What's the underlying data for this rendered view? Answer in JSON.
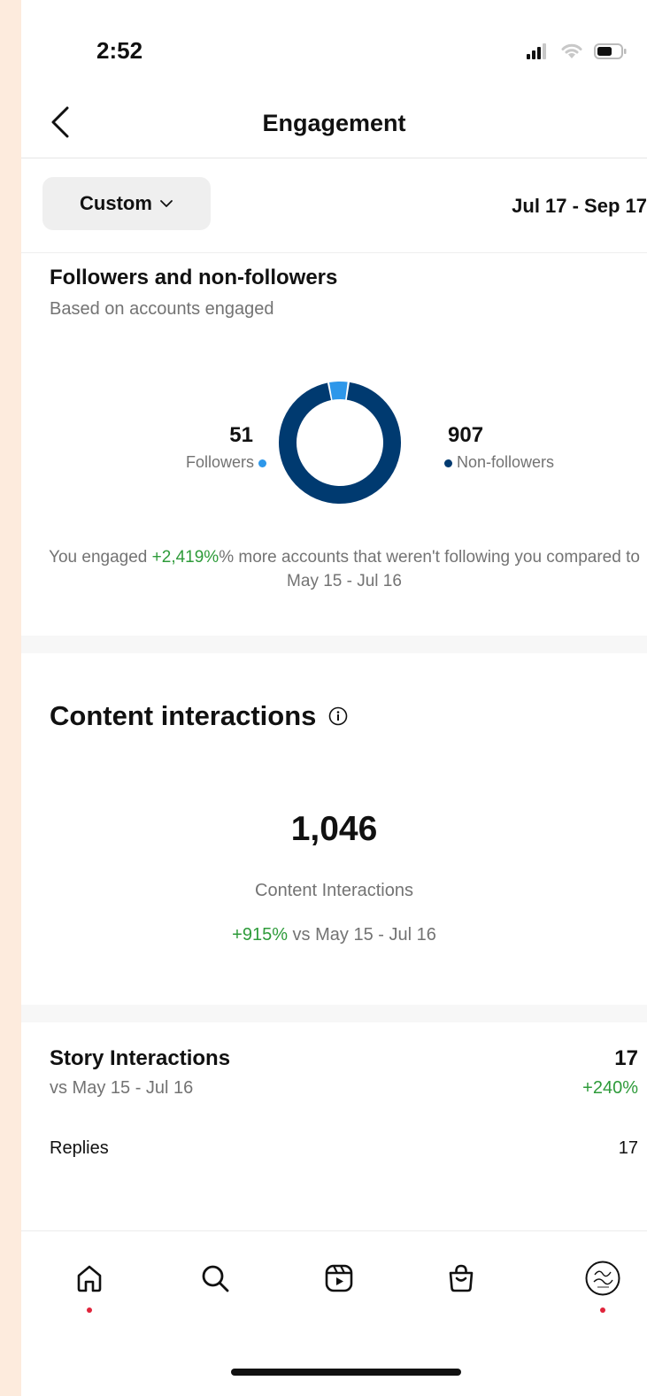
{
  "status_bar": {
    "time": "2:52"
  },
  "nav": {
    "title": "Engagement"
  },
  "filter": {
    "period_label": "Custom",
    "date_range": "Jul 17 - Sep 17"
  },
  "followers_section": {
    "title": "Followers and non-followers",
    "subtitle": "Based on accounts engaged",
    "followers_count": "51",
    "followers_label": "Followers",
    "nonfollowers_count": "907",
    "nonfollowers_label": "Non-followers",
    "note_prefix": "You engaged ",
    "note_highlight": "+2,419%",
    "note_suffix": "% more accounts that weren't following you compared to May 15 - Jul 16"
  },
  "chart_data": {
    "type": "pie",
    "categories": [
      "Followers",
      "Non-followers"
    ],
    "values": [
      51,
      907
    ]
  },
  "content_interactions": {
    "title": "Content interactions",
    "value": "1,046",
    "label": "Content Interactions",
    "change": "+915%",
    "change_suffix": " vs May 15 - Jul 16"
  },
  "story_interactions": {
    "title": "Story Interactions",
    "subtitle": "vs May 15 - Jul 16",
    "count": "17",
    "change": "+240%",
    "replies_label": "Replies",
    "replies_value": "17"
  },
  "colors": {
    "followers": "#2d97ea",
    "nonfollowers": "#003a70",
    "positive": "#2e9b3a",
    "notification": "#e0243b"
  },
  "bottom_nav": {
    "tabs": [
      "home-icon",
      "search-icon",
      "reels-icon",
      "shop-icon",
      "profile-avatar"
    ]
  }
}
